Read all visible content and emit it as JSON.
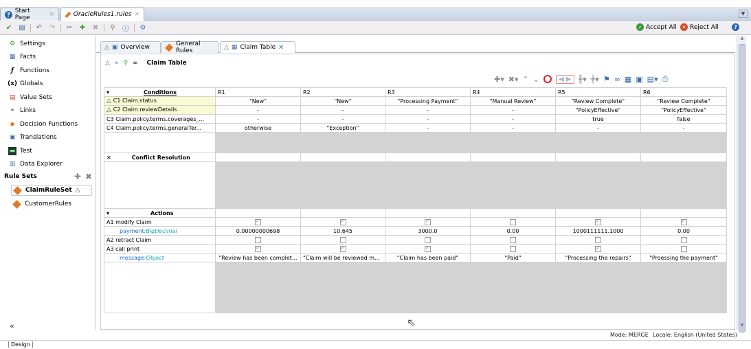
{
  "doc_tabs": {
    "start_page": "Start Page",
    "rules_file": "OracleRules1.rules",
    "close_glyph": "×"
  },
  "toolbar": {
    "accept_all": "Accept All",
    "reject_all": "Reject All"
  },
  "left_nav": {
    "items": [
      {
        "label": "Settings",
        "icon": "settings-icon"
      },
      {
        "label": "Facts",
        "icon": "facts-icon"
      },
      {
        "label": "Functions",
        "icon": "functions-icon"
      },
      {
        "label": "Globals",
        "icon": "globals-icon"
      },
      {
        "label": "Value Sets",
        "icon": "value-sets-icon"
      },
      {
        "label": "Links",
        "icon": "links-icon"
      },
      {
        "label": "Decision Functions",
        "icon": "decision-functions-icon"
      },
      {
        "label": "Translations",
        "icon": "translations-icon"
      },
      {
        "label": "Test",
        "icon": "test-icon"
      },
      {
        "label": "Data Explorer",
        "icon": "data-explorer-icon"
      }
    ],
    "rule_sets_header": "Rule Sets",
    "rule_sets": [
      {
        "label": "ClaimRuleSet",
        "selected": true
      },
      {
        "label": "CustomerRules",
        "selected": false
      }
    ],
    "collapse": "«"
  },
  "editor_tabs": {
    "overview": "Overview",
    "general_rules": "General Rules",
    "claim_table": "Claim Table"
  },
  "panel_title": "Claim Table",
  "grid": {
    "columns": [
      "R1",
      "R2",
      "R3",
      "R4",
      "R5",
      "R6"
    ],
    "conditions_header": "Conditions",
    "conditions": [
      {
        "label": "C1  Claim.status",
        "values": [
          "\"New\"",
          "\"New\"",
          "\"Processing Payment\"",
          "\"Manual Review\"",
          "\"Review Complete\"",
          "\"Review Complete\""
        ]
      },
      {
        "label": "C2  Claim.reviewDetails",
        "values": [
          "-",
          "-",
          "-",
          "-",
          "\"PolicyEffective\"",
          "\"PolicyEffective\""
        ]
      },
      {
        "label": "C3 Claim.policy.terms.coverages_...",
        "values": [
          "-",
          "-",
          "-",
          "-",
          "true",
          "false"
        ]
      },
      {
        "label": "C4 Claim.policy.terms.generalTer...",
        "values": [
          "otherwise",
          "\"Exception\"",
          "-",
          "-",
          "-",
          "-"
        ]
      }
    ],
    "conflict_header": "Conflict Resolution",
    "actions_header": "Actions",
    "actions": {
      "a1_label": "A1  modify Claim",
      "a1_checks": [
        true,
        true,
        true,
        false,
        true,
        true
      ],
      "payment_label": "payment",
      "payment_type": ":BigDecimal",
      "payment_values": [
        "0.00000000698",
        "10.645",
        "3000.0",
        "0.00",
        "1000111111.1000",
        "0.00"
      ],
      "a2_label": "A2  retract Claim",
      "a2_checks": [
        false,
        false,
        false,
        false,
        false,
        false
      ],
      "a3_label": "A3  call print",
      "a3_checks": [
        true,
        true,
        true,
        false,
        true,
        false
      ],
      "message_label": "message",
      "message_type": ":Object",
      "message_values": [
        "\"Review has been complet...",
        "\"Claim will be reviewed ma...",
        "\"Claim has been paid\"",
        "\"Paid\"",
        "\"Processing the repairs\"",
        "\"Proessing the payment\""
      ]
    }
  },
  "status": {
    "mode": "Mode: MERGE",
    "locale": "Locale: English (United States)"
  },
  "bottom_tab": "Design"
}
